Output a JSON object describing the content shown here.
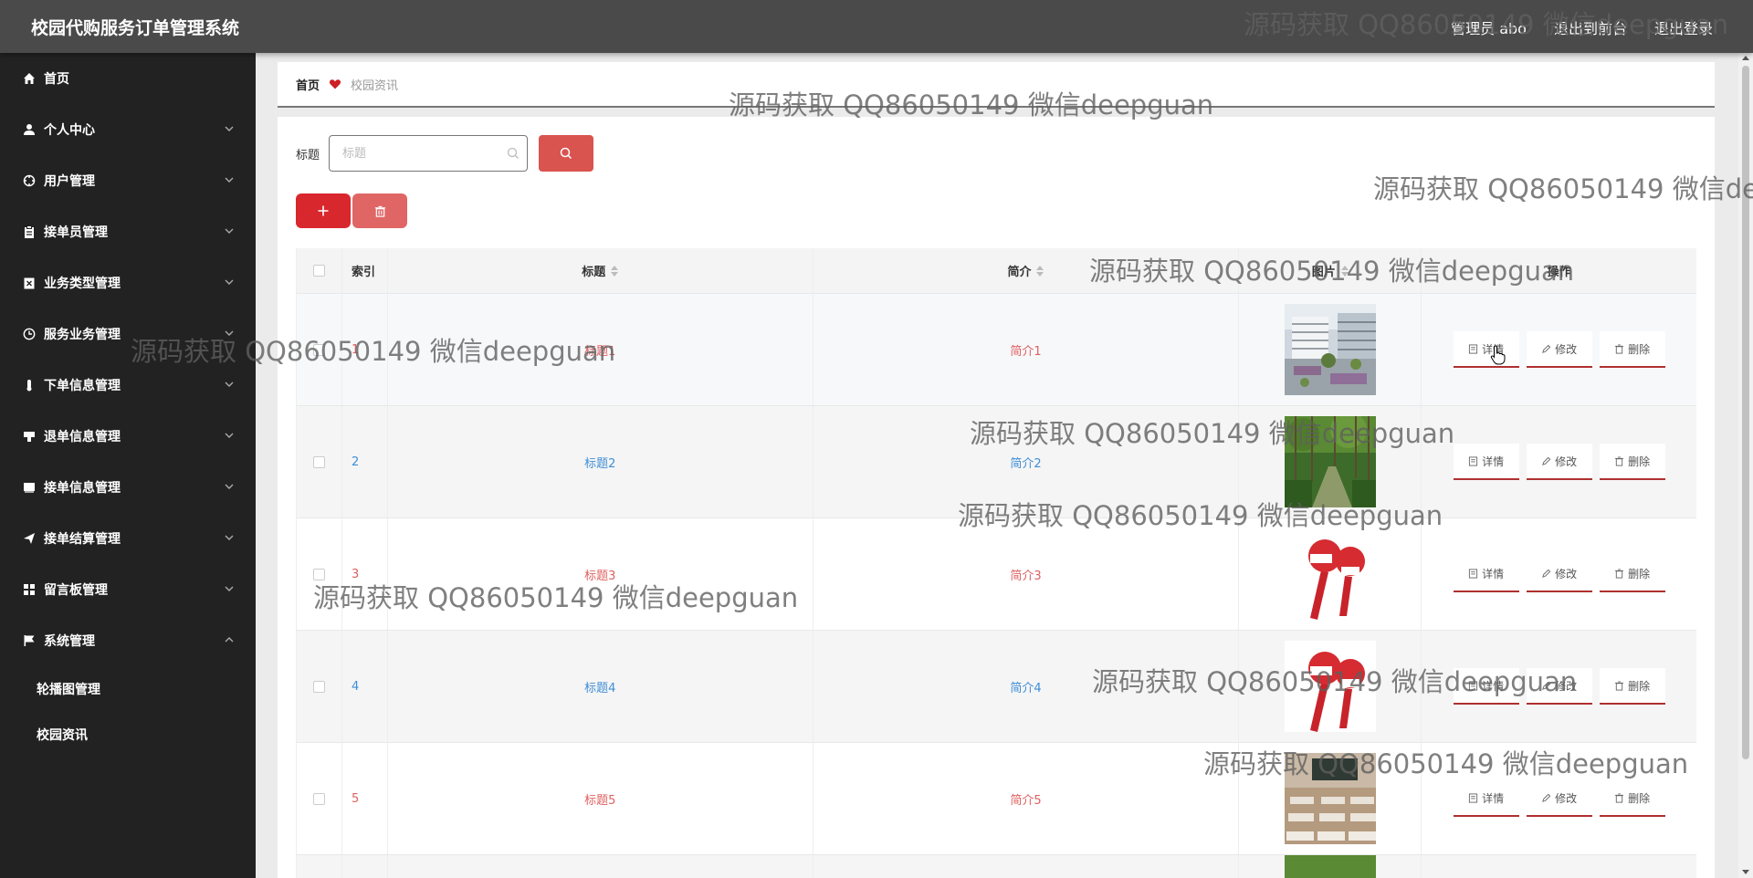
{
  "header": {
    "app_title": "校园代购服务订单管理系统",
    "admin": "管理员 abo",
    "back_to_front": "退出到前台",
    "logout": "退出登录"
  },
  "sidebar": {
    "items": [
      {
        "label": "首页",
        "icon": "home-icon"
      },
      {
        "label": "个人中心",
        "icon": "user-icon"
      },
      {
        "label": "用户管理",
        "icon": "crosshair-icon"
      },
      {
        "label": "接单员管理",
        "icon": "clipboard-icon"
      },
      {
        "label": "业务类型管理",
        "icon": "x-box-icon"
      },
      {
        "label": "服务业务管理",
        "icon": "clock-icon"
      },
      {
        "label": "下单信息管理",
        "icon": "thermometer-icon"
      },
      {
        "label": "退单信息管理",
        "icon": "cup-icon"
      },
      {
        "label": "接单信息管理",
        "icon": "book-icon"
      },
      {
        "label": "接单结算管理",
        "icon": "send-icon"
      },
      {
        "label": "留言板管理",
        "icon": "grid-icon"
      },
      {
        "label": "系统管理",
        "icon": "flag-icon"
      }
    ],
    "sub_items": [
      {
        "label": "轮播图管理"
      },
      {
        "label": "校园资讯"
      }
    ]
  },
  "breadcrumb": {
    "home": "首页",
    "current": "校园资讯"
  },
  "search": {
    "label": "标题",
    "placeholder": "标题"
  },
  "table": {
    "headers": {
      "index": "索引",
      "title": "标题",
      "intro": "简介",
      "image": "图片",
      "ops": "操作"
    },
    "rows": [
      {
        "index": "1",
        "title": "标题1",
        "intro": "简介1",
        "image": "building-courtyard"
      },
      {
        "index": "2",
        "title": "标题2",
        "intro": "简介2",
        "image": "forest-path"
      },
      {
        "index": "3",
        "title": "标题3",
        "intro": "简介3",
        "image": "news-microphones"
      },
      {
        "index": "4",
        "title": "标题4",
        "intro": "简介4",
        "image": "news-microphones"
      },
      {
        "index": "5",
        "title": "标题5",
        "intro": "简介5",
        "image": "classroom"
      }
    ],
    "op_labels": {
      "detail": "详情",
      "edit": "修改",
      "delete": "删除"
    }
  },
  "watermark": "源码获取 QQ86050149 微信deepguan",
  "colors": {
    "header_bg": "#4a4a4a",
    "sidebar_bg": "#222222",
    "accent_red": "#d9272e",
    "link_blue": "#3f8ed6",
    "link_red": "#e06060"
  }
}
